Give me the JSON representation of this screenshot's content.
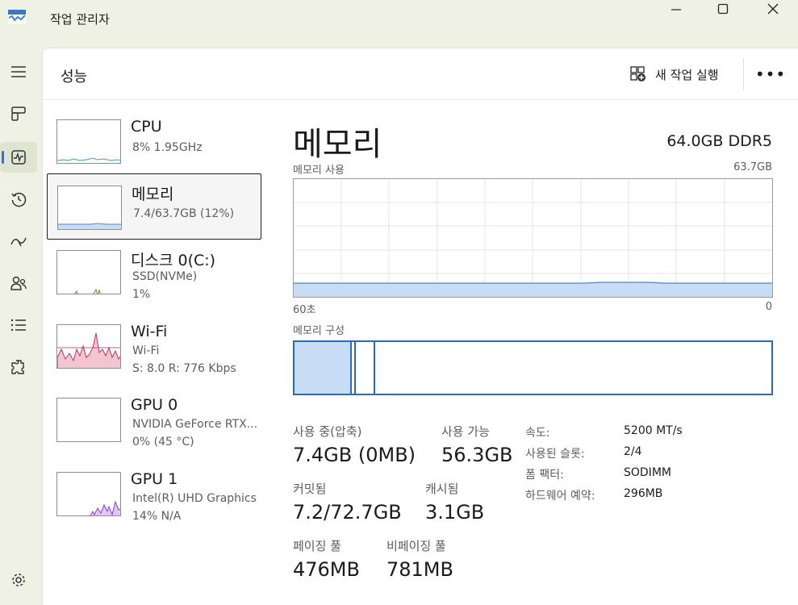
{
  "app": {
    "title": "작업 관리자"
  },
  "nav": [
    {
      "icon": "hamburger-menu-icon"
    },
    {
      "icon": "processes-icon"
    },
    {
      "icon": "performance-icon",
      "active": true
    },
    {
      "icon": "app-history-icon"
    },
    {
      "icon": "startup-apps-icon"
    },
    {
      "icon": "users-icon"
    },
    {
      "icon": "details-icon"
    },
    {
      "icon": "services-icon"
    },
    {
      "icon": "settings-icon"
    }
  ],
  "header": {
    "title": "성능",
    "new_task_label": "새 작업 실행",
    "more_label": "•••"
  },
  "devices": [
    {
      "name": "CPU",
      "sub1": "8% 1.95GHz",
      "sub2": ""
    },
    {
      "name": "메모리",
      "sub1": "7.4/63.7GB (12%)",
      "sub2": ""
    },
    {
      "name": "디스크 0(C:)",
      "sub1": "SSD(NVMe)",
      "sub2": "1%"
    },
    {
      "name": "Wi-Fi",
      "sub1": "Wi-Fi",
      "sub2": "S: 8.0  R: 776 Kbps"
    },
    {
      "name": "GPU 0",
      "sub1": "NVIDIA GeForce RTX...",
      "sub2": "0% (45 °C)"
    },
    {
      "name": "GPU 1",
      "sub1": "Intel(R) UHD Graphics",
      "sub2": "14% N/A"
    }
  ],
  "detail": {
    "title": "메모리",
    "spec": "64.0GB DDR5",
    "usage_label": "메모리 사용",
    "usage_max": "63.7GB",
    "time_left": "60초",
    "time_right": "0",
    "composition_label": "메모리 구성",
    "stats": [
      {
        "label": "사용 중(압축)",
        "value": "7.4GB (0MB)"
      },
      {
        "label": "사용 가능",
        "value": "56.3GB"
      },
      {
        "label": "커밋됨",
        "value": "7.2/72.7GB"
      },
      {
        "label": "캐시됨",
        "value": "3.1GB"
      },
      {
        "label": "페이징 풀",
        "value": "476MB"
      },
      {
        "label": "비페이징 풀",
        "value": "781MB"
      }
    ],
    "props": [
      {
        "key": "속도:",
        "value": "5200 MT/s"
      },
      {
        "key": "사용된 슬롯:",
        "value": "2/4"
      },
      {
        "key": "폼 팩터:",
        "value": "SODIMM"
      },
      {
        "key": "하드웨어 예약:",
        "value": "296MB"
      }
    ]
  },
  "colors": {
    "memory_fill": "#c9dcf5",
    "memory_line": "#4f86c6",
    "composition_border": "#2d6ab3",
    "cpu_line": "#3c9ac1",
    "disk_line": "#4d9a1f",
    "wifi_line": "#b9345f",
    "wifi_fill": "#f3c4d2",
    "gpu_line": "#8a3bd1"
  }
}
